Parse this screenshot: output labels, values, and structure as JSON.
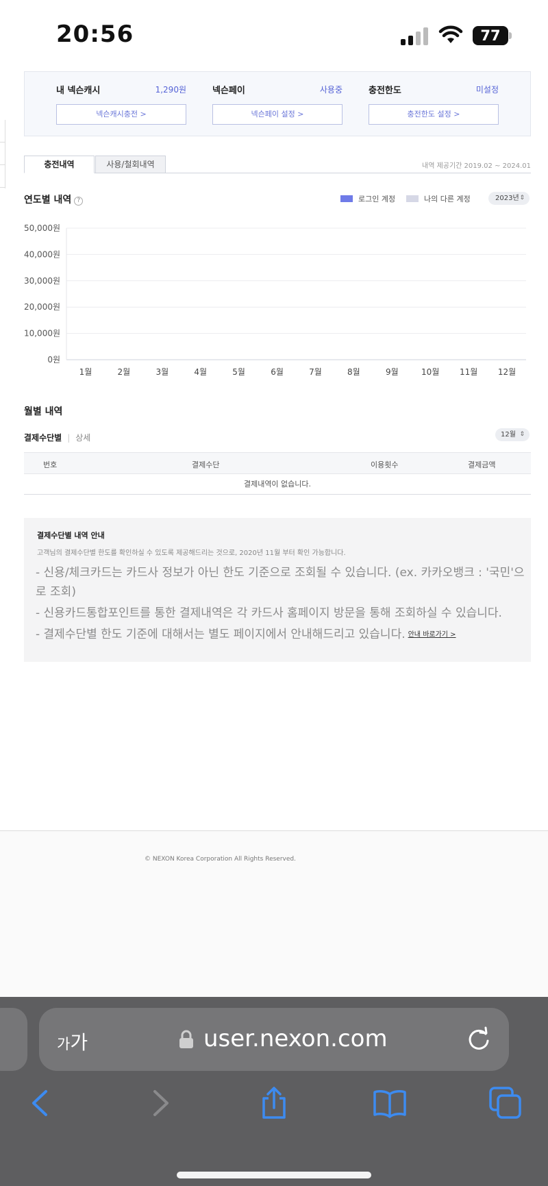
{
  "status_bar": {
    "time": "20:56",
    "battery": "77"
  },
  "summary": {
    "cash": {
      "label": "내 넥슨캐시",
      "value": "1,290원",
      "button": "넥슨캐시충전 >"
    },
    "pay": {
      "label": "넥슨페이",
      "value": "사용중",
      "button": "넥슨페이 설정 >"
    },
    "limit": {
      "label": "충전한도",
      "value": "미설정",
      "button": "충전한도 설정 >"
    }
  },
  "tabs": {
    "charge": "충전내역",
    "usage": "사용/철회내역",
    "period": "내역 제공기간 2019.02 ~ 2024.01"
  },
  "yearly": {
    "title": "연도별 내역",
    "help": "?",
    "legend_login": "로그인 계정",
    "legend_other": "나의 다른 계정",
    "year_select": "2023년",
    "colors": {
      "login": "#6f7be8",
      "other": "#d6d8e6",
      "accent": "#5563d6"
    }
  },
  "chart_data": {
    "type": "bar",
    "categories": [
      "1월",
      "2월",
      "3월",
      "4월",
      "5월",
      "6월",
      "7월",
      "8월",
      "9월",
      "10월",
      "11월",
      "12월"
    ],
    "series": [
      {
        "name": "로그인 계정",
        "values": [
          0,
          0,
          0,
          0,
          0,
          0,
          0,
          0,
          0,
          0,
          0,
          0
        ]
      },
      {
        "name": "나의 다른 계정",
        "values": [
          0,
          0,
          0,
          0,
          0,
          0,
          0,
          0,
          0,
          0,
          0,
          0
        ]
      }
    ],
    "yticks": [
      "0원",
      "10,000원",
      "20,000원",
      "30,000원",
      "40,000원",
      "50,000원"
    ],
    "ylim": [
      0,
      50000
    ],
    "grid": true,
    "legend": "top-right"
  },
  "monthly": {
    "title": "월별 내역",
    "tab_method": "결제수단별",
    "tab_detail": "상세",
    "month_select": "12월",
    "columns": [
      "번호",
      "결제수단",
      "이용횟수",
      "결제금액"
    ],
    "empty_message": "결제내역이 없습니다."
  },
  "notice": {
    "title": "결제수단별 내역 안내",
    "desc": "고객님의 결제수단별 한도를 확인하실 수 있도록 제공해드리는 것으로, 2020년 11월 부터 확인 가능합니다.",
    "items": [
      "- 신용/체크카드는 카드사 정보가 아닌 한도 기준으로 조회될 수 있습니다. (ex. 카카오뱅크 : '국민'으로 조회)",
      "- 신용카드통합포인트를 통한 결제내역은 각 카드사 홈페이지 방문을 통해 조회하실 수 있습니다.",
      "- 결제수단별 한도 기준에 대해서는 별도 페이지에서 안내해드리고 있습니다."
    ],
    "link": "안내 바로가기 >"
  },
  "footer": {
    "copyright": "© NEXON Korea Corporation All Rights Reserved."
  },
  "browser": {
    "aa_small": "가",
    "aa_large": "가",
    "url": "user.nexon.com"
  }
}
